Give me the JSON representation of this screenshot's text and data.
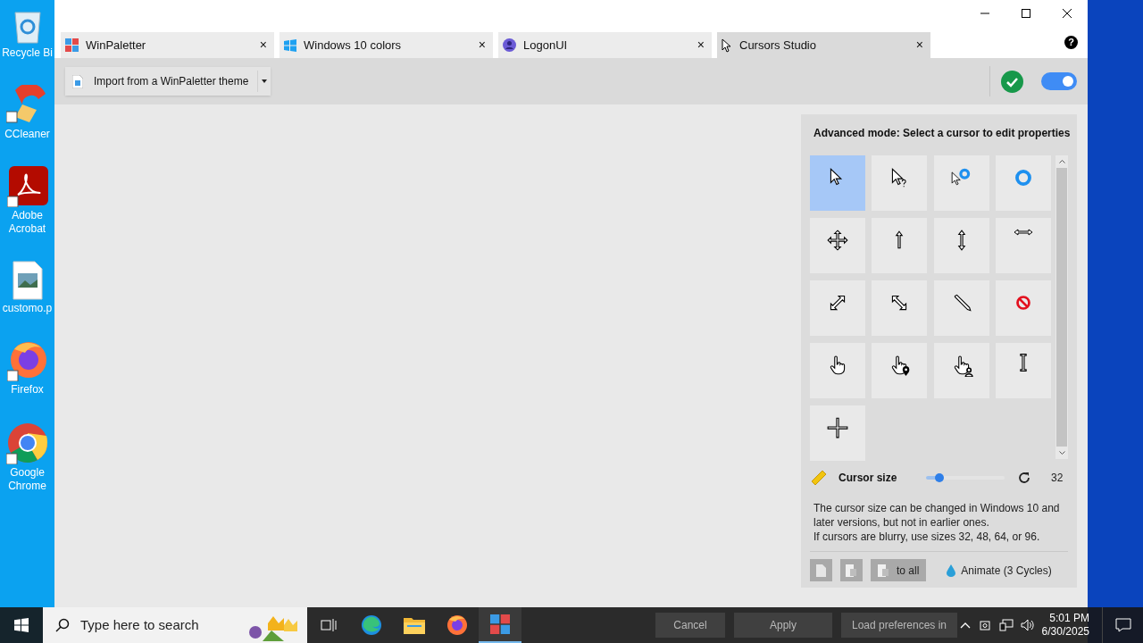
{
  "desktop_icons": [
    {
      "kind": "recycle",
      "label": "Recycle Bi"
    },
    {
      "kind": "ccleaner",
      "label": "CCleaner"
    },
    {
      "kind": "acrobat",
      "label": "Adobe Acrobat"
    },
    {
      "kind": "image",
      "label": "customo.p"
    },
    {
      "kind": "firefox",
      "label": "Firefox"
    },
    {
      "kind": "chrome",
      "label": "Google Chrome"
    }
  ],
  "window": {
    "tabs": [
      {
        "kind": "winpaletter",
        "label": "WinPaletter",
        "close": "×",
        "selected": false
      },
      {
        "kind": "windows",
        "label": "Windows 10 colors",
        "close": "×",
        "selected": false
      },
      {
        "kind": "user",
        "label": "LogonUI",
        "close": "×",
        "selected": false
      },
      {
        "kind": "cursor",
        "label": "Cursors Studio",
        "close": "×",
        "selected": true
      }
    ],
    "help": "?",
    "toolbar": {
      "import_button": "Import from a WinPaletter theme",
      "enabled": true
    },
    "panel": {
      "title": "Advanced mode: Select a cursor to edit properties",
      "cursors": [
        {
          "kind": "arrow",
          "selected": true
        },
        {
          "kind": "help",
          "selected": false
        },
        {
          "kind": "working",
          "selected": false
        },
        {
          "kind": "busy",
          "selected": false
        },
        {
          "kind": "move",
          "selected": false
        },
        {
          "kind": "up",
          "selected": false
        },
        {
          "kind": "ns",
          "selected": false
        },
        {
          "kind": "ew",
          "selected": false
        },
        {
          "kind": "nesw",
          "selected": false
        },
        {
          "kind": "nwse",
          "selected": false
        },
        {
          "kind": "pen",
          "selected": false
        },
        {
          "kind": "unavailable",
          "selected": false
        },
        {
          "kind": "hand",
          "selected": false
        },
        {
          "kind": "pin",
          "selected": false
        },
        {
          "kind": "person",
          "selected": false
        },
        {
          "kind": "text",
          "selected": false
        },
        {
          "kind": "cross",
          "selected": false
        }
      ],
      "size": {
        "label": "Cursor size",
        "level": 0.17,
        "value": "32"
      },
      "note": "The cursor size can be changed in Windows 10 and later versions, but not in earlier ones.\nIf cursors are blurry, use sizes 32, 48, 64, or 96.",
      "apply_all": "to all",
      "animate": "Animate (3 Cycles)"
    },
    "footer": [
      "Cancel",
      "Apply",
      "Load preferences in"
    ]
  },
  "taskbar": {
    "search_placeholder": "Type here to search",
    "apps": [
      {
        "kind": "taskview",
        "active": false
      },
      {
        "kind": "edge",
        "active": false
      },
      {
        "kind": "explorer",
        "active": false
      },
      {
        "kind": "firefox",
        "active": false
      },
      {
        "kind": "winpaletter",
        "active": true
      }
    ],
    "time": "5:01 PM",
    "date": "6/30/2025"
  }
}
